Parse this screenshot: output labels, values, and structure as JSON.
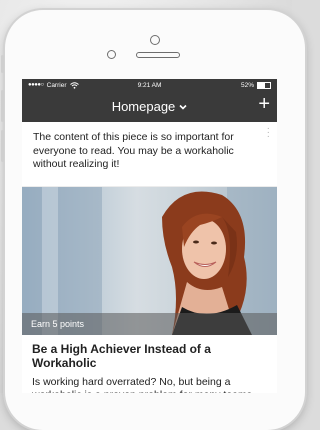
{
  "status_bar": {
    "carrier": "Carrier",
    "time": "9:21 AM",
    "battery": "52%"
  },
  "nav": {
    "title": "Homepage",
    "add_label": "+"
  },
  "intro_card": {
    "text": "The content of this piece is so important for everyone to read. You may be a workaholic without realizing it!"
  },
  "feature": {
    "badge": "Earn 5 points",
    "title": "Be a High Achiever Instead of a Workaholic",
    "body": "Is working hard overrated? No, but being a workaholic is a proven problem for many teams. Learn how to work smarter."
  },
  "colors": {
    "nav_bg": "#3a3a3a"
  }
}
